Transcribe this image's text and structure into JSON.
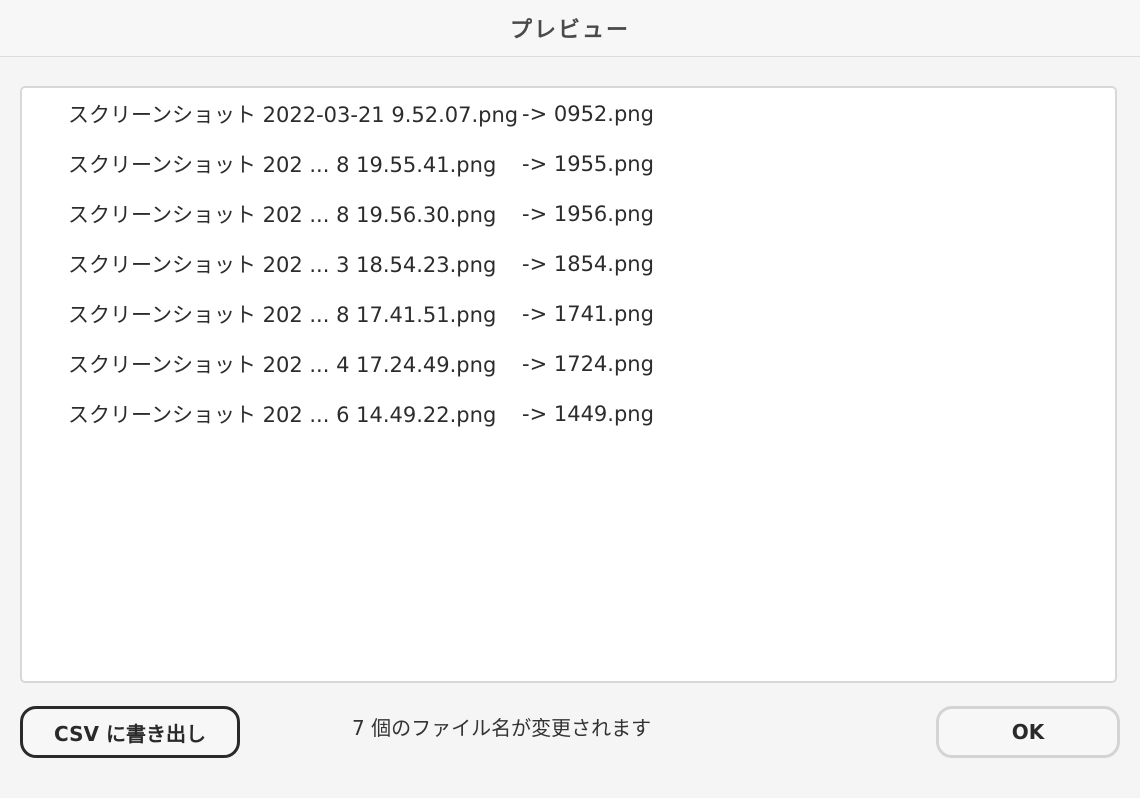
{
  "dialog": {
    "title": "プレビュー"
  },
  "rename_list": [
    {
      "source": "スクリーンショット 2022-03-21 9.52.07.png",
      "target": "-> 0952.png"
    },
    {
      "source": "スクリーンショット 202 ... 8 19.55.41.png",
      "target": "-> 1955.png"
    },
    {
      "source": "スクリーンショット 202 ... 8 19.56.30.png",
      "target": "-> 1956.png"
    },
    {
      "source": "スクリーンショット 202 ... 3 18.54.23.png",
      "target": "-> 1854.png"
    },
    {
      "source": "スクリーンショット 202 ... 8 17.41.51.png",
      "target": "-> 1741.png"
    },
    {
      "source": "スクリーンショット 202 ... 4 17.24.49.png",
      "target": "-> 1724.png"
    },
    {
      "source": "スクリーンショット 202 ... 6 14.49.22.png",
      "target": "-> 1449.png"
    }
  ],
  "footer": {
    "csv_button_label": "CSV に書き出し",
    "status": "7 個のファイル名が変更されます",
    "ok_button_label": "OK"
  }
}
